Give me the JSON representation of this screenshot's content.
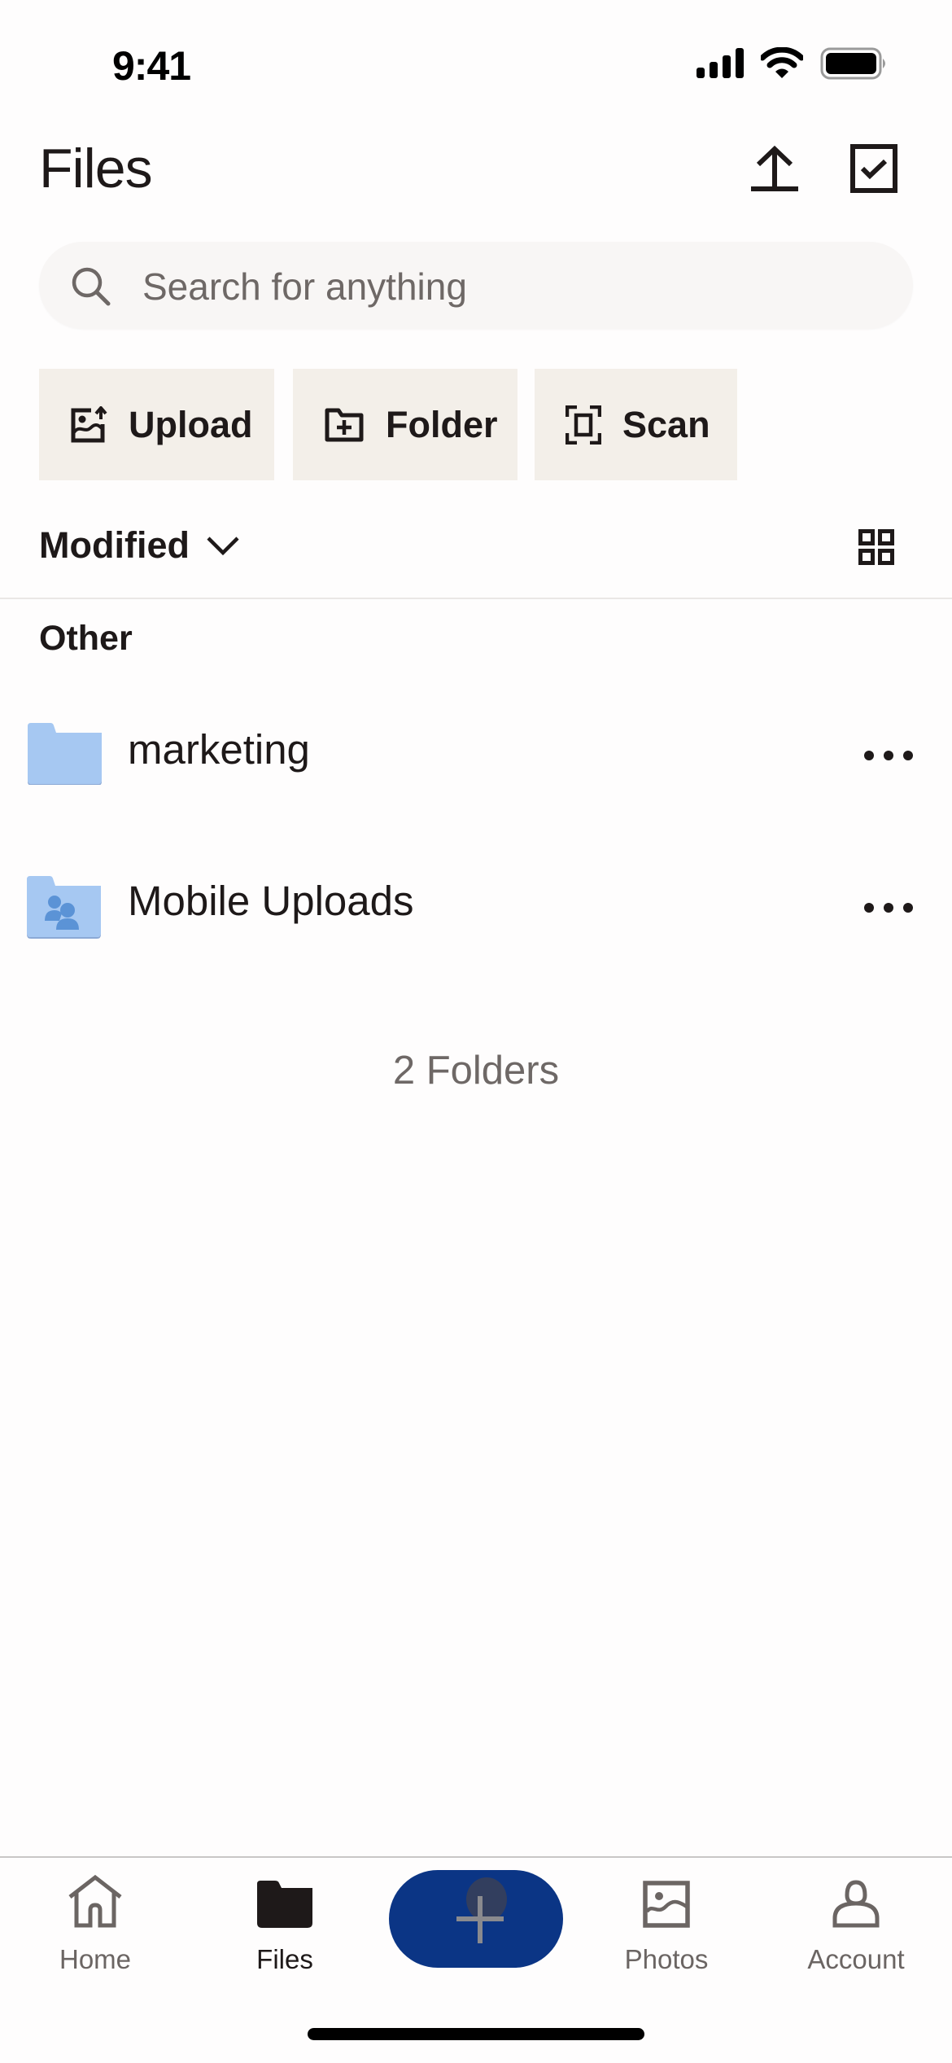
{
  "status_bar": {
    "time": "9:41",
    "icons": [
      "signal-icon",
      "wifi-icon",
      "battery-icon"
    ]
  },
  "header": {
    "title": "Files",
    "actions": [
      {
        "icon": "upload-icon",
        "label": "Upload"
      },
      {
        "icon": "select-checkbox-icon",
        "label": "Select"
      }
    ]
  },
  "search": {
    "placeholder": "Search for anything",
    "value": ""
  },
  "quick_actions": [
    {
      "icon": "upload-photo-icon",
      "label": "Upload"
    },
    {
      "icon": "create-folder-icon",
      "label": "Folder"
    },
    {
      "icon": "scan-icon",
      "label": "Scan"
    }
  ],
  "sort": {
    "label": "Modified",
    "view_toggle_icon": "grid-view-icon"
  },
  "sections": [
    {
      "label": "Other",
      "items": [
        {
          "name": "marketing",
          "type": "folder",
          "icon": "folder-icon"
        },
        {
          "name": "Mobile Uploads",
          "type": "shared-folder",
          "icon": "shared-folder-icon"
        }
      ]
    }
  ],
  "summary": "2 Folders",
  "tabbar": {
    "tabs": [
      {
        "label": "Home",
        "icon": "home-icon",
        "active": false
      },
      {
        "label": "Files",
        "icon": "folder-icon",
        "active": true
      },
      {
        "label": "Photos",
        "icon": "photos-icon",
        "active": false
      },
      {
        "label": "Account",
        "icon": "account-icon",
        "active": false
      }
    ],
    "fab": {
      "icon": "plus-icon",
      "label": "Create"
    }
  },
  "colors": {
    "accent": "#0B3585",
    "button_bg": "#F3EFE9",
    "search_bg": "#F8F6F5",
    "folder": "#A6C8F2",
    "text_primary": "#1E1919",
    "text_secondary": "#6E6866"
  }
}
